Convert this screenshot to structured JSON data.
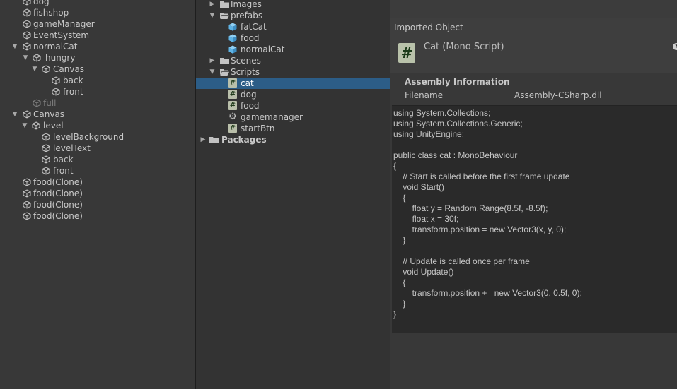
{
  "hierarchy": {
    "items": [
      {
        "label": "dog"
      },
      {
        "label": "fishshop"
      },
      {
        "label": "gameManager"
      },
      {
        "label": "EventSystem"
      },
      {
        "label": "normalCat"
      },
      {
        "label": "hungry"
      },
      {
        "label": "Canvas"
      },
      {
        "label": "back"
      },
      {
        "label": "front"
      },
      {
        "label": "full"
      },
      {
        "label": "Canvas"
      },
      {
        "label": "level"
      },
      {
        "label": "levelBackground"
      },
      {
        "label": "levelText"
      },
      {
        "label": "back"
      },
      {
        "label": "front"
      },
      {
        "label": "food(Clone)"
      },
      {
        "label": "food(Clone)"
      },
      {
        "label": "food(Clone)"
      },
      {
        "label": "food(Clone)"
      }
    ]
  },
  "project": {
    "items": [
      {
        "label": "Images"
      },
      {
        "label": "prefabs"
      },
      {
        "label": "fatCat"
      },
      {
        "label": "food"
      },
      {
        "label": "normalCat"
      },
      {
        "label": "Scenes"
      },
      {
        "label": "Scripts"
      },
      {
        "label": "cat"
      },
      {
        "label": "dog"
      },
      {
        "label": "food"
      },
      {
        "label": "gamemanager"
      },
      {
        "label": "startBtn"
      },
      {
        "label": "Packages"
      }
    ],
    "selected": "cat"
  },
  "inspector": {
    "title": "Imported Object",
    "object_name": "Cat (Mono Script)",
    "assembly_title": "Assembly Information",
    "filename_label": "Filename",
    "filename_value": "Assembly-CSharp.dll",
    "code_lines": [
      "using System.Collections;",
      "using System.Collections.Generic;",
      "using UnityEngine;",
      "",
      "public class cat : MonoBehaviour",
      "{",
      "    // Start is called before the first frame update",
      "    void Start()",
      "    {",
      "        float y = Random.Range(8.5f, -8.5f);",
      "        float x = 30f;",
      "        transform.position = new Vector3(x, y, 0);",
      "    }",
      "",
      "    // Update is called once per frame",
      "    void Update()",
      "    {",
      "        transform.position += new Vector3(0, 0.5f, 0);",
      "    }",
      "}"
    ]
  },
  "colors": {
    "selection": "#2c5d87",
    "prefab_blue": "#5fb4e6"
  }
}
